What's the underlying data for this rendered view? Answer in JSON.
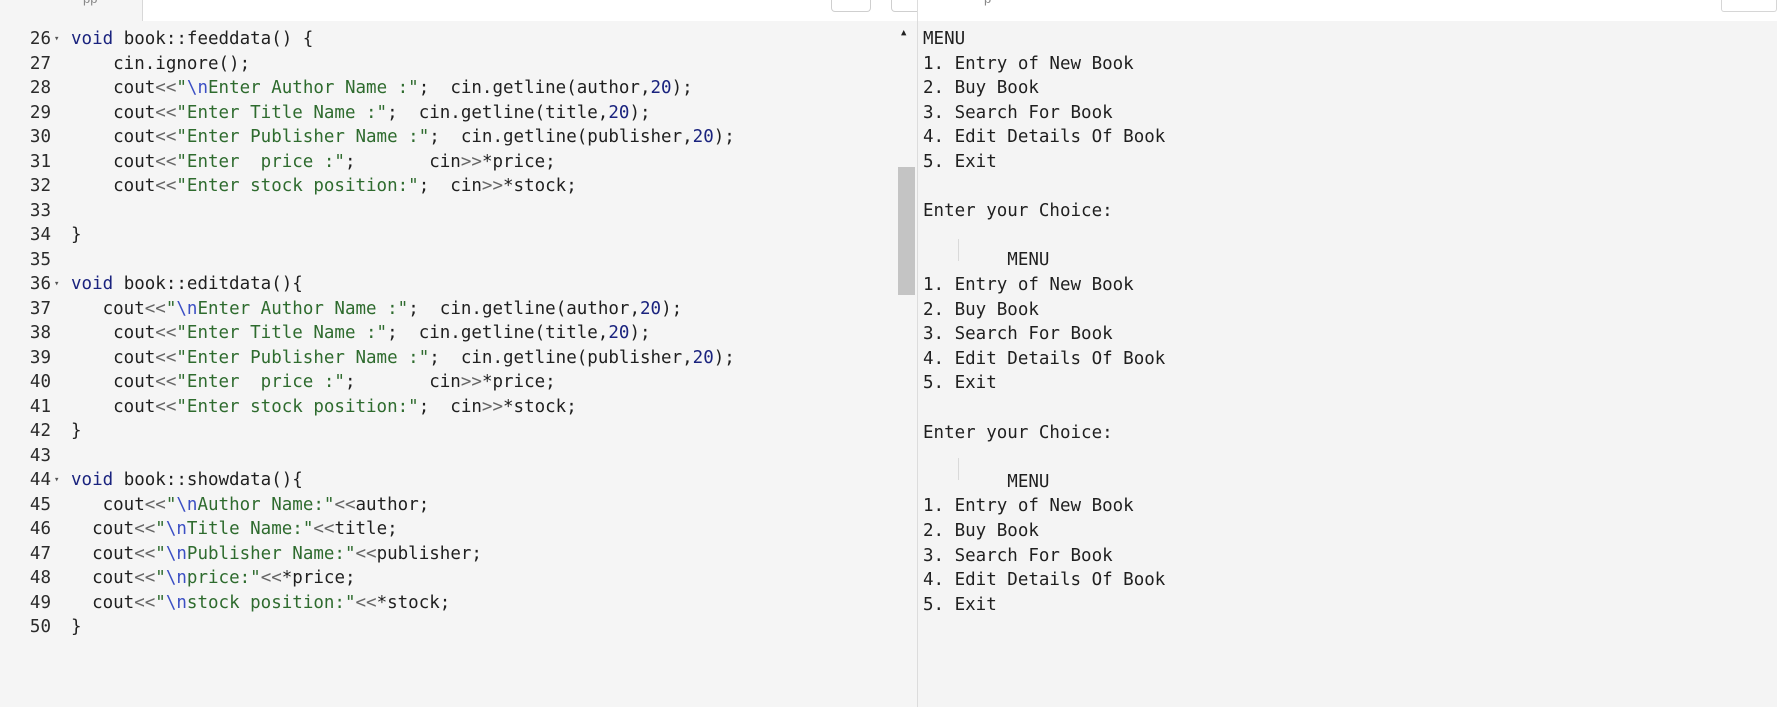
{
  "tab": {
    "label": "pp"
  },
  "output_header": {
    "label": "p"
  },
  "editor": {
    "lines": [
      {
        "n": "26",
        "fold": true,
        "html": "<span class='kw'>void</span> book::feeddata() {"
      },
      {
        "n": "27",
        "fold": false,
        "html": "    cin.ignore();"
      },
      {
        "n": "28",
        "fold": false,
        "html": "    cout<span class='op'>&lt;&lt;</span><span class='str'>\"</span><span class='esc'>\\n</span><span class='str'>Enter Author Name :\"</span>;  cin.getline(author,<span class='num'>20</span>);"
      },
      {
        "n": "29",
        "fold": false,
        "html": "    cout<span class='op'>&lt;&lt;</span><span class='str'>\"Enter Title Name :\"</span>;  cin.getline(title,<span class='num'>20</span>);"
      },
      {
        "n": "30",
        "fold": false,
        "html": "    cout<span class='op'>&lt;&lt;</span><span class='str'>\"Enter Publisher Name :\"</span>;  cin.getline(publisher,<span class='num'>20</span>);"
      },
      {
        "n": "31",
        "fold": false,
        "html": "    cout<span class='op'>&lt;&lt;</span><span class='str'>\"Enter  price :\"</span>;       cin<span class='op'>&gt;&gt;</span>*price;"
      },
      {
        "n": "32",
        "fold": false,
        "html": "    cout<span class='op'>&lt;&lt;</span><span class='str'>\"Enter stock position:\"</span>;  cin<span class='op'>&gt;&gt;</span>*stock;"
      },
      {
        "n": "33",
        "fold": false,
        "html": ""
      },
      {
        "n": "34",
        "fold": false,
        "html": "}"
      },
      {
        "n": "35",
        "fold": false,
        "html": ""
      },
      {
        "n": "36",
        "fold": true,
        "html": "<span class='kw'>void</span> book::editdata(){"
      },
      {
        "n": "37",
        "fold": false,
        "html": "   cout<span class='op'>&lt;&lt;</span><span class='str'>\"</span><span class='esc'>\\n</span><span class='str'>Enter Author Name :\"</span>;  cin.getline(author,<span class='num'>20</span>);"
      },
      {
        "n": "38",
        "fold": false,
        "html": "    cout<span class='op'>&lt;&lt;</span><span class='str'>\"Enter Title Name :\"</span>;  cin.getline(title,<span class='num'>20</span>);"
      },
      {
        "n": "39",
        "fold": false,
        "html": "    cout<span class='op'>&lt;&lt;</span><span class='str'>\"Enter Publisher Name :\"</span>;  cin.getline(publisher,<span class='num'>20</span>);"
      },
      {
        "n": "40",
        "fold": false,
        "html": "    cout<span class='op'>&lt;&lt;</span><span class='str'>\"Enter  price :\"</span>;       cin<span class='op'>&gt;&gt;</span>*price;"
      },
      {
        "n": "41",
        "fold": false,
        "html": "    cout<span class='op'>&lt;&lt;</span><span class='str'>\"Enter stock position:\"</span>;  cin<span class='op'>&gt;&gt;</span>*stock;"
      },
      {
        "n": "42",
        "fold": false,
        "html": "}"
      },
      {
        "n": "43",
        "fold": false,
        "html": ""
      },
      {
        "n": "44",
        "fold": true,
        "html": "<span class='kw'>void</span> book::showdata(){"
      },
      {
        "n": "45",
        "fold": false,
        "html": "   cout<span class='op'>&lt;&lt;</span><span class='str'>\"</span><span class='esc'>\\n</span><span class='str'>Author Name:\"</span><span class='op'>&lt;&lt;</span>author;"
      },
      {
        "n": "46",
        "fold": false,
        "html": "  cout<span class='op'>&lt;&lt;</span><span class='str'>\"</span><span class='esc'>\\n</span><span class='str'>Title Name:\"</span><span class='op'>&lt;&lt;</span>title;"
      },
      {
        "n": "47",
        "fold": false,
        "html": "  cout<span class='op'>&lt;&lt;</span><span class='str'>\"</span><span class='esc'>\\n</span><span class='str'>Publisher Name:\"</span><span class='op'>&lt;&lt;</span>publisher;"
      },
      {
        "n": "48",
        "fold": false,
        "html": "  cout<span class='op'>&lt;&lt;</span><span class='str'>\"</span><span class='esc'>\\n</span><span class='str'>price:\"</span><span class='op'>&lt;&lt;</span>*price;"
      },
      {
        "n": "49",
        "fold": false,
        "html": "  cout<span class='op'>&lt;&lt;</span><span class='str'>\"</span><span class='esc'>\\n</span><span class='str'>stock position:\"</span><span class='op'>&lt;&lt;</span>*stock;"
      },
      {
        "n": "50",
        "fold": false,
        "html": "}"
      }
    ]
  },
  "output": {
    "lines": [
      "MENU",
      "1. Entry of New Book",
      "2. Buy Book",
      "3. Search For Book",
      "4. Edit Details Of Book",
      "5. Exit",
      "",
      "Enter your Choice:",
      "",
      "        MENU",
      "1. Entry of New Book",
      "2. Buy Book",
      "3. Search For Book",
      "4. Edit Details Of Book",
      "5. Exit",
      "",
      "Enter your Choice:",
      "",
      "        MENU",
      "1. Entry of New Book",
      "2. Buy Book",
      "3. Search For Book",
      "4. Edit Details Of Book",
      "5. Exit"
    ]
  },
  "scrollbar": {
    "up_arrow": "▲"
  },
  "fold_glyph": "▾"
}
